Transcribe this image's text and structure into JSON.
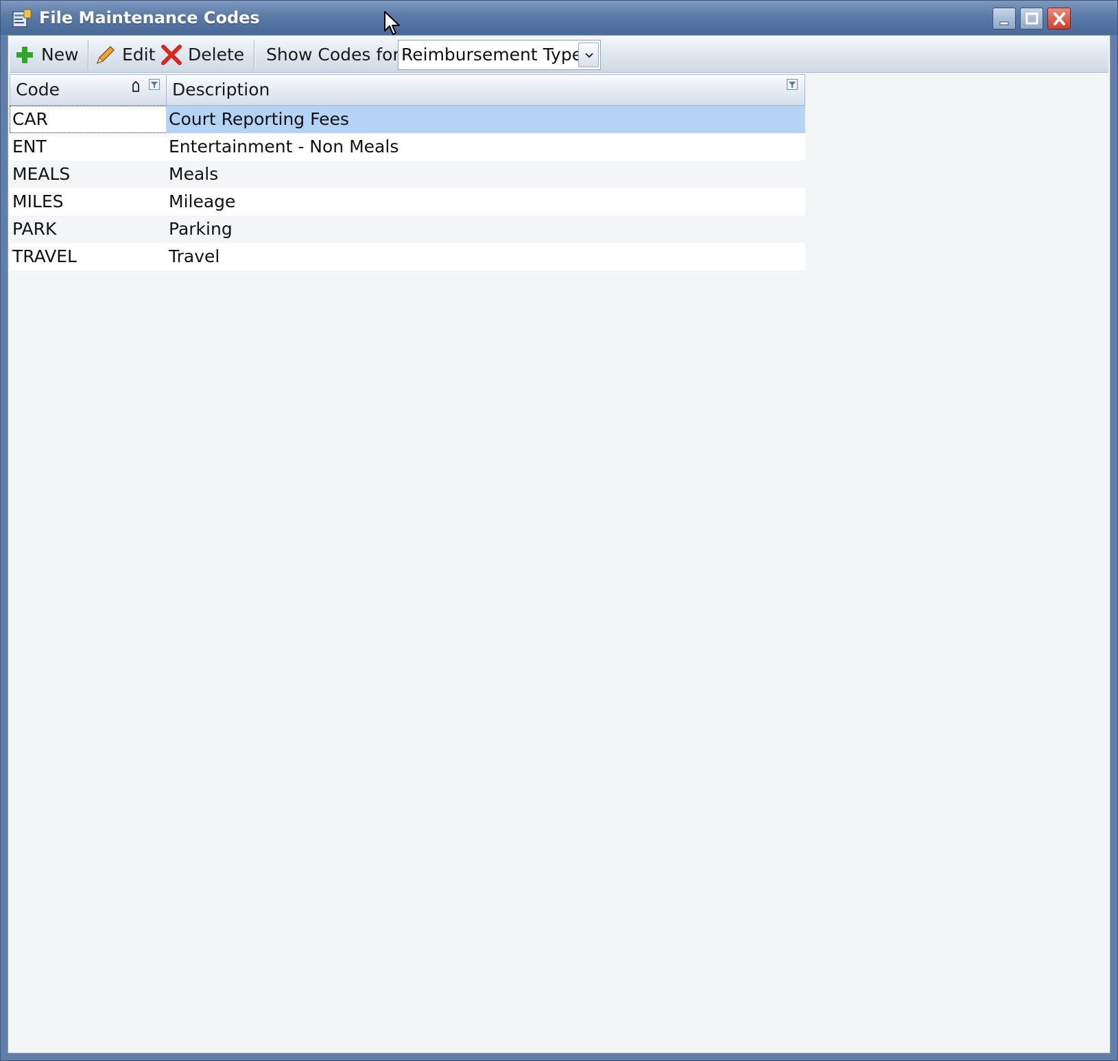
{
  "window": {
    "title": "File Maintenance Codes"
  },
  "toolbar": {
    "new_label": "New",
    "edit_label": "Edit",
    "delete_label": "Delete",
    "show_codes_label": "Show Codes for",
    "show_codes_value": "Reimbursement Types"
  },
  "grid": {
    "columns": [
      "Code",
      "Description"
    ],
    "sorted_column": "Code",
    "rows": [
      {
        "code": "CAR",
        "description": "Court Reporting Fees"
      },
      {
        "code": "ENT",
        "description": "Entertainment - Non Meals"
      },
      {
        "code": "MEALS",
        "description": "Meals"
      },
      {
        "code": "MILES",
        "description": "Mileage"
      },
      {
        "code": "PARK",
        "description": "Parking"
      },
      {
        "code": "TRAVEL",
        "description": "Travel"
      }
    ],
    "selected_row": 0
  },
  "colors": {
    "selection": "#b4d3f5",
    "titlebar": "#5a7aa6",
    "close_button": "#c8402d"
  }
}
